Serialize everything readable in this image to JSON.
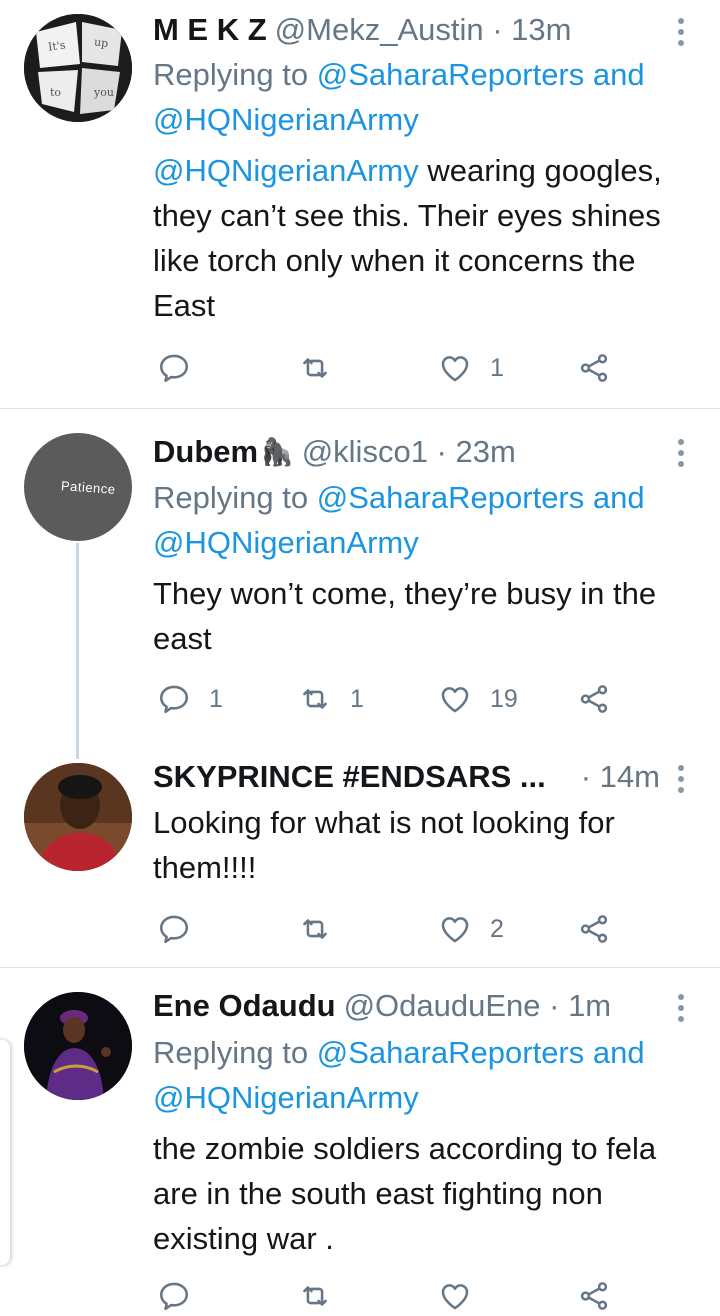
{
  "tweets": [
    {
      "name": "M E K Z",
      "handle": "@Mekz_Austin · 13m",
      "replying_prefix": "Replying to ",
      "replying_links": "@SaharaReporters and @HQNigerianArmy",
      "mention": "@HQNigerianArmy",
      "body": " wearing googles, they can’t see this. Their eyes shines like torch only when it concerns the East",
      "reply_count": "",
      "retweet_count": "",
      "like_count": "1",
      "avatar_words": [
        "It's",
        "up",
        "to",
        "you"
      ]
    },
    {
      "name": "Dubem",
      "emoji": "🦍",
      "handle": "@klisco1 · 23m",
      "replying_prefix": "Replying to ",
      "replying_links": "@SaharaReporters and @HQNigerianArmy",
      "body": "They won’t come, they’re busy in the east",
      "reply_count": "1",
      "retweet_count": "1",
      "like_count": "19",
      "avatar_text": "Patience"
    },
    {
      "name": "SKYPRINCE #ENDSARS ...",
      "handle": "· 14m",
      "body": "Looking for what is not looking for them!!!!",
      "reply_count": "",
      "retweet_count": "",
      "like_count": "2"
    },
    {
      "name": "Ene Odaudu",
      "handle": "@OdauduEne · 1m",
      "replying_prefix": "Replying to ",
      "replying_links": "@SaharaReporters and @HQNigerianArmy",
      "body": "the zombie soldiers according to fela are in the south east fighting non existing war .",
      "reply_count": "",
      "retweet_count": "",
      "like_count": ""
    }
  ],
  "icons": [
    "reply-icon",
    "retweet-icon",
    "like-icon",
    "share-icon",
    "more-options-icon"
  ],
  "colors": {
    "link": "#1b95e0",
    "secondary": "#657786",
    "divider": "#dde3e8",
    "thread": "#ccd6dd"
  }
}
